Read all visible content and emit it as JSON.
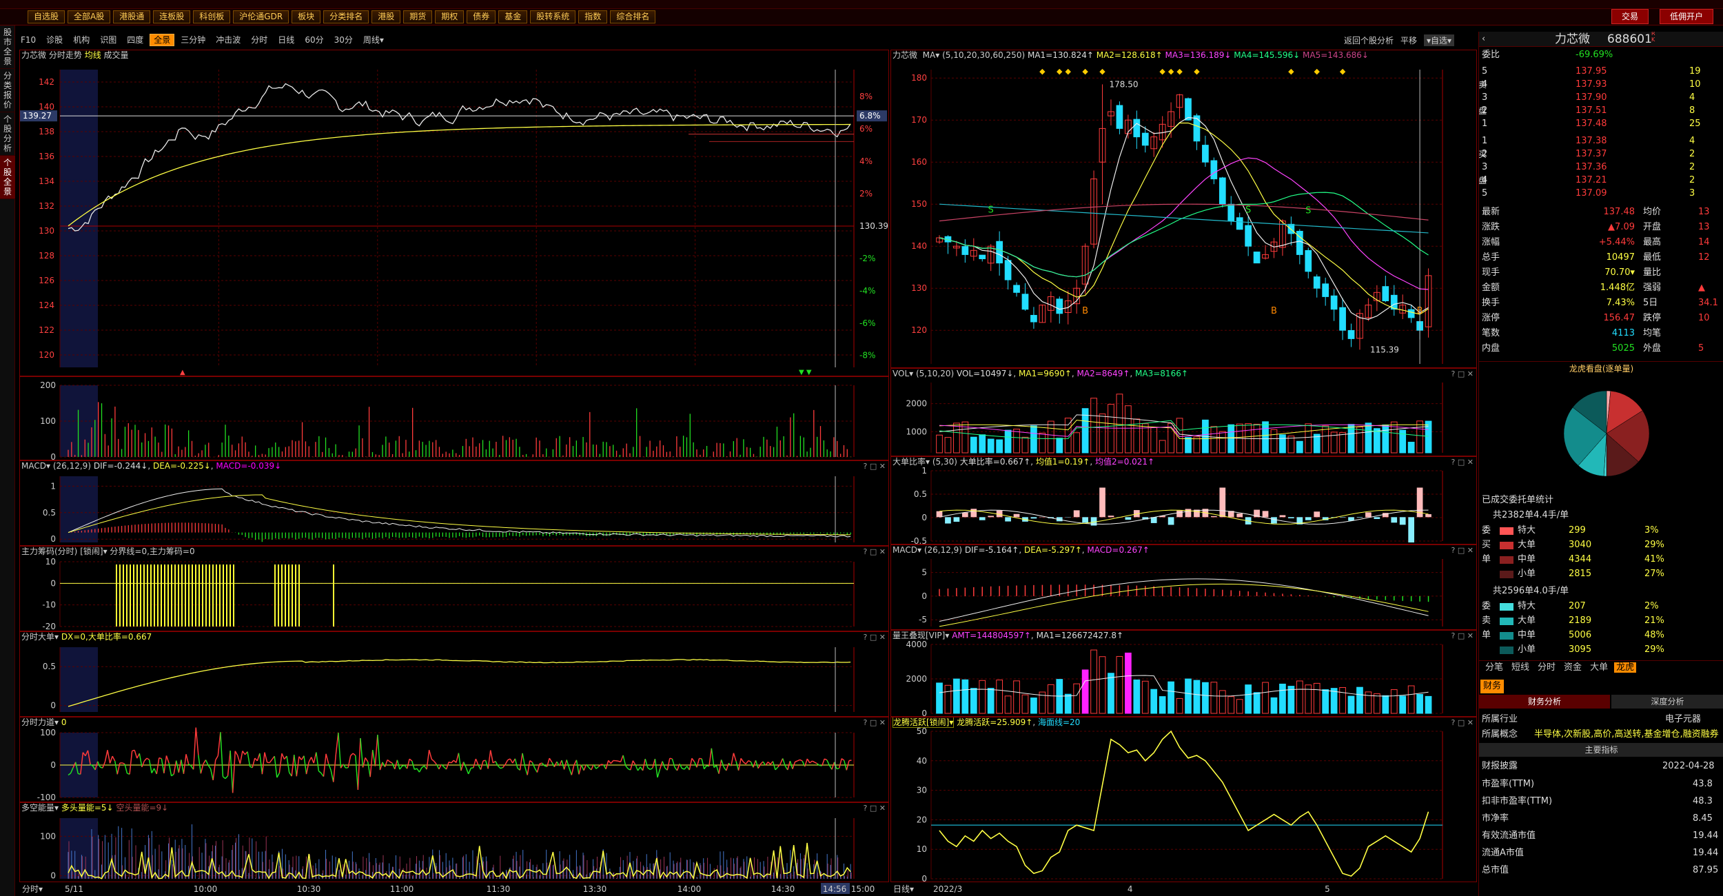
{
  "menu": {
    "items": [
      "自选股",
      "全部A股",
      "港股通",
      "连板股",
      "科创板",
      "沪伦通GDR",
      "板块",
      "分类排名",
      "港股",
      "期货",
      "期权",
      "债券",
      "基金",
      "股转系统",
      "指数",
      "综合排名"
    ],
    "trade": "交易",
    "open_account": "低佣开户"
  },
  "sidebar": {
    "items": [
      "股市全景",
      "分类报价",
      "个股分析",
      "个股全景"
    ]
  },
  "subtabs": [
    "F10",
    "诊股",
    "机构",
    "识图",
    "四度",
    "全景",
    "三分钟",
    "冲击波",
    "分时",
    "日线",
    "60分",
    "30分",
    "周线▾"
  ],
  "right_tabs": {
    "back": "返回个股分析",
    "mode": "平移",
    "select": "▾自选▾"
  },
  "intraday": {
    "name": "力芯微",
    "title": "分时走势",
    "avg": "均线",
    "vol_label": "成交量",
    "prices": [
      "142",
      "140",
      "138",
      "136",
      "134",
      "132",
      "130",
      "128",
      "126",
      "124",
      "122",
      "120"
    ],
    "pcts": [
      "8%",
      "6%",
      "4%",
      "2%",
      "",
      "-2%",
      "-4%",
      "-6%",
      "-8%"
    ],
    "prev_close": "130.39",
    "cur_price": "139.27",
    "cur_pct": "6.8%",
    "times": [
      "5/11",
      "10:00",
      "10:30",
      "11:00",
      "11:30",
      "13:30",
      "14:00",
      "14:30",
      "14:56",
      "15:00"
    ],
    "vol_ticks": [
      "200",
      "100",
      "0"
    ],
    "macd": {
      "label": "MACD▾",
      "params": "(26,12,9)",
      "dif": "DIF=-0.244↓",
      "dea": "DEA=-0.225↓",
      "m": "MACD=-0.039↓",
      "ticks": [
        "1",
        "0.5",
        "0"
      ]
    },
    "chip": {
      "label": "主力筹码(分时)",
      "lock": "[锁闹]▾",
      "text": "分界线=0,主力筹码=0",
      "ticks": [
        "10",
        "0",
        "-10",
        "-20"
      ]
    },
    "big": {
      "label": "分时大单▾",
      "text": "DX=0,大单比率=0.667",
      "ticks": [
        "0.5",
        "0"
      ]
    },
    "force": {
      "label": "分时力道▾",
      "text": "0",
      "ticks": [
        "100",
        "0",
        "-100"
      ]
    },
    "multi": {
      "label": "多空能量▾",
      "t1": "多头量能=5↓",
      "t2": "空头量能=9↓",
      "ticks": [
        "100",
        "0"
      ]
    },
    "bottom_label": "分时▾"
  },
  "daily": {
    "name": "力芯微",
    "ma_label": "MA▾",
    "ma_params": "(5,10,20,30,60,250)",
    "ma1": "MA1=130.824↑",
    "ma2": "MA2=128.618↑",
    "ma3": "MA3=136.189↓",
    "ma4": "MA4=145.596↓",
    "ma5": "MA5=143.686↓",
    "high_label": "178.50",
    "low_label": "115.39",
    "price_ticks": [
      "180",
      "170",
      "160",
      "150",
      "140",
      "130",
      "120"
    ],
    "vol": {
      "label": "VOL▾",
      "params": "(5,10,20)",
      "v": "VOL=10497↓",
      "m1": "MA1=9690↑",
      "m2": "MA2=8649↑",
      "m3": "MA3=8166↑",
      "ticks": [
        "2000",
        "1000"
      ]
    },
    "bigratio": {
      "label": "大单比率▾",
      "params": "(5,30)",
      "v": "大单比率=0.667↑",
      "m1": "均值1=0.19↑",
      "m2": "均值2=0.021↑",
      "ticks": [
        "1",
        "0.5",
        "0",
        "-0.5"
      ]
    },
    "macd": {
      "label": "MACD▾",
      "params": "(26,12,9)",
      "dif": "DIF=-5.164↑",
      "dea": "DEA=-5.297↑",
      "m": "MACD=0.267↑",
      "ticks": [
        "5",
        "0",
        "-5"
      ]
    },
    "amt": {
      "label": "量王叠现[VIP]▾",
      "v": "AMT=144804597↑",
      "m1": "MA1=126672427.8↑",
      "ticks": [
        "4000",
        "2000",
        "0"
      ]
    },
    "dragon": {
      "label": "龙腾活跃[锁闹]▾",
      "v": "龙腾活跃=25.909↑",
      "h": "海面线=20",
      "ticks": [
        "50",
        "40",
        "30",
        "20",
        "10",
        "0"
      ]
    },
    "x_labels": [
      "2022/3",
      "4",
      "5"
    ],
    "bottom_label": "日线▾"
  },
  "quote": {
    "name": "力芯微",
    "code": "688601",
    "wb_label": "委比",
    "wb": "-69.69%",
    "asks": [
      [
        "5",
        "137.95",
        "19"
      ],
      [
        "4",
        "137.93",
        "10"
      ],
      [
        "3",
        "137.90",
        "4"
      ],
      [
        "2",
        "137.51",
        "8"
      ],
      [
        "1",
        "137.48",
        "25"
      ]
    ],
    "bids": [
      [
        "1",
        "137.38",
        "4"
      ],
      [
        "2",
        "137.37",
        "2"
      ],
      [
        "3",
        "137.36",
        "2"
      ],
      [
        "4",
        "137.21",
        "2"
      ],
      [
        "5",
        "137.09",
        "3"
      ]
    ],
    "ask_side": "卖",
    "bid_side": "买",
    "pan": "盘",
    "stats": [
      [
        "最新",
        "137.48",
        "均价",
        "13"
      ],
      [
        "涨跌",
        "▲7.09",
        "开盘",
        "13"
      ],
      [
        "涨幅",
        "+5.44%",
        "最高",
        "14"
      ],
      [
        "总手",
        "10497",
        "最低",
        "12"
      ],
      [
        "现手",
        "70.70▾",
        "量比",
        ""
      ],
      [
        "金额",
        "1.448亿",
        "强弱",
        "▲"
      ],
      [
        "换手",
        "7.43%",
        "5日",
        "34.1"
      ],
      [
        "涨停",
        "156.47",
        "跌停",
        "10"
      ],
      [
        "笔数",
        "4113",
        "均笔",
        ""
      ],
      [
        "内盘",
        "5025",
        "外盘",
        "5"
      ]
    ],
    "pie_title": "龙虎看盘(逐单量)",
    "deal_title": "已成交委托单统计",
    "buy_total": "共2382单4.4手/单",
    "sell_total": "共2596单4.0手/单",
    "buy_rows": [
      [
        "委",
        "特大",
        "299",
        "3%"
      ],
      [
        "买",
        "大单",
        "3040",
        "29%"
      ],
      [
        "单",
        "中单",
        "4344",
        "41%"
      ],
      [
        "",
        "小单",
        "2815",
        "27%"
      ]
    ],
    "sell_rows": [
      [
        "委",
        "特大",
        "207",
        "2%"
      ],
      [
        "卖",
        "大单",
        "2189",
        "21%"
      ],
      [
        "单",
        "中单",
        "5006",
        "48%"
      ],
      [
        "",
        "小单",
        "3095",
        "29%"
      ]
    ],
    "tabs": [
      "分笔",
      "短线",
      "分时",
      "资金",
      "大单",
      "龙虎"
    ],
    "fin_tab": "财务",
    "fin_analysis": "财务分析",
    "deep_analysis": "深度分析",
    "industry_label": "所属行业",
    "industry": "电子元器",
    "concept_label": "所属概念",
    "concept": "半导体,次新股,高价,高送转,基金增仓,融资融券",
    "main_index": "主要指标",
    "report_label": "财报披露",
    "report_date": "2022-04-28",
    "fin": [
      [
        "市盈率(TTM)",
        "43.8"
      ],
      [
        "扣非市盈率(TTM)",
        "48.3"
      ],
      [
        "市净率",
        "8.45"
      ],
      [
        "有效流通市值",
        "19.44"
      ],
      [
        "流通A市值",
        "19.44"
      ],
      [
        "总市值",
        "87.95"
      ]
    ]
  },
  "colors": {
    "up": "#ff3b3b",
    "down": "#22e022",
    "cyan": "#22ddff",
    "yellow": "#ffff44",
    "magenta": "#ff33ff",
    "grid": "#7a0000"
  }
}
